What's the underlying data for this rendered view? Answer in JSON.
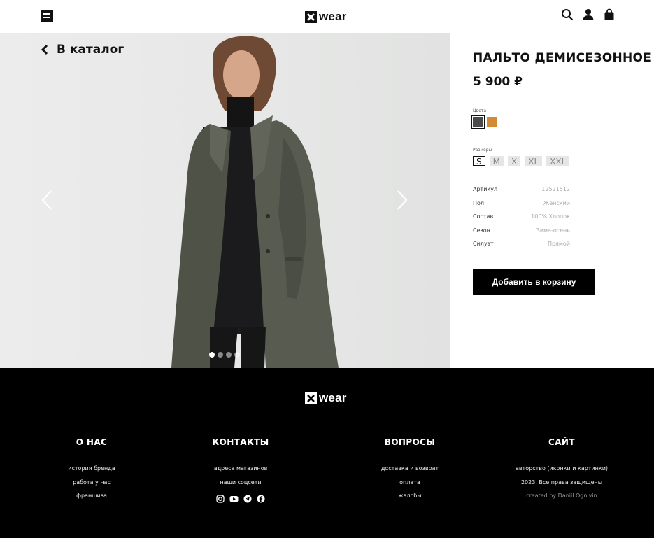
{
  "header": {
    "logo_text": "wear",
    "icons": [
      "menu-icon",
      "search-icon",
      "user-icon",
      "bag-icon"
    ]
  },
  "hero": {
    "back_label": "В каталог",
    "slides": 4,
    "active_slide": 1
  },
  "product": {
    "title": "ПАЛЬТО ДЕМИСЕЗОННОЕ",
    "price": "5 900 ₽",
    "colors_caption": "Цвета",
    "colors": [
      {
        "name": "Серый",
        "hex": "#4a4a4a",
        "selected": true
      },
      {
        "name": "Горчичный",
        "hex": "#d48a32",
        "selected": false
      }
    ],
    "sizes_caption": "Размеры",
    "sizes": [
      "S",
      "M",
      "X",
      "XL",
      "XXL"
    ],
    "selected_size": "S",
    "specs": [
      {
        "label": "Артикул",
        "value": "12521512"
      },
      {
        "label": "Пол",
        "value": "Женский"
      },
      {
        "label": "Состав",
        "value": "100% Хлопок"
      },
      {
        "label": "Сезон",
        "value": "Зима-осень"
      },
      {
        "label": "Силуэт",
        "value": "Прямой"
      }
    ],
    "add_to_cart_label": "Добавить в корзину"
  },
  "footer": {
    "logo_text": "wear",
    "columns": [
      {
        "title": "О НАС",
        "links": [
          "история бренда",
          "работа у нас",
          "франшиза"
        ]
      },
      {
        "title": "КОНТАКТЫ",
        "links": [
          "адреса магазинов",
          "наши соцсети"
        ]
      },
      {
        "title": "ВОПРОСЫ",
        "links": [
          "доставка и возврат",
          "оплата",
          "жалобы"
        ]
      },
      {
        "title": "САЙТ",
        "links": [
          "авторство (иконки и картинки)",
          "2023. Все права защищены",
          "created by Daniil Ognivin"
        ]
      }
    ],
    "socials": [
      "instagram-icon",
      "youtube-icon",
      "telegram-icon",
      "facebook-icon"
    ]
  }
}
